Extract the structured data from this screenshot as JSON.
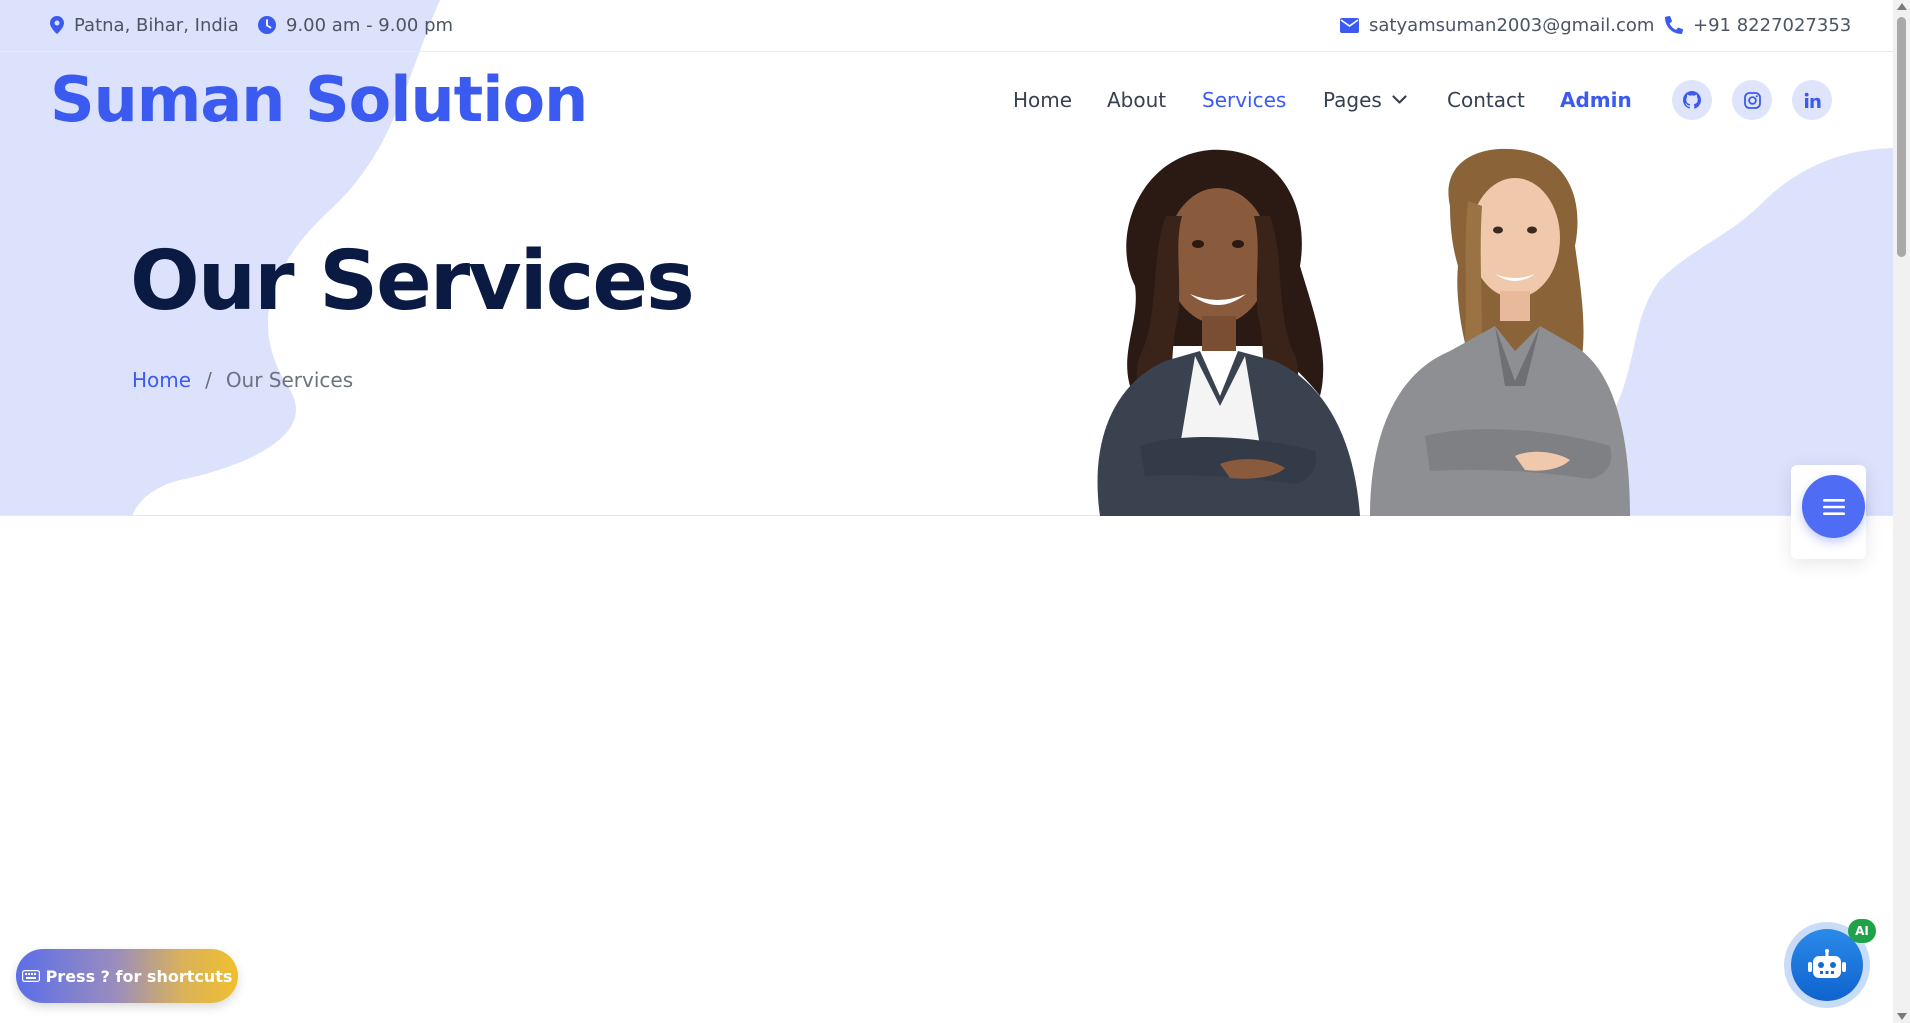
{
  "topbar": {
    "location": "Patna, Bihar, India",
    "hours": "9.00 am - 9.00 pm",
    "email": "satyamsuman2003@gmail.com",
    "phone": "+91 8227027353"
  },
  "brand": "Suman Solution",
  "nav": {
    "items": [
      {
        "label": "Home"
      },
      {
        "label": "About"
      },
      {
        "label": "Services"
      },
      {
        "label": "Pages"
      },
      {
        "label": "Contact"
      },
      {
        "label": "Admin"
      }
    ],
    "active": "Services",
    "social_icons": [
      "github-icon",
      "instagram-icon",
      "linkedin-icon"
    ]
  },
  "hero": {
    "title": "Our Services",
    "breadcrumb": {
      "home": "Home",
      "separator": "/",
      "current": "Our Services"
    }
  },
  "shortcuts_hint": "Press ? for shortcuts",
  "ai_badge": "AI",
  "colors": {
    "accent": "#3b5bf0",
    "hero_blob": "#dce1fc",
    "heading": "#0a1a43",
    "ai_badge": "#1fa24a"
  }
}
